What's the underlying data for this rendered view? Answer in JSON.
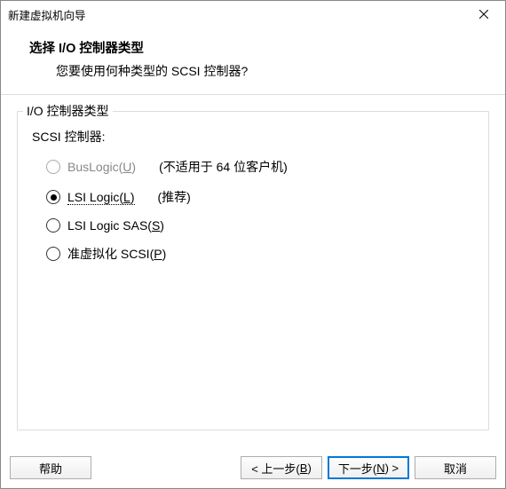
{
  "title": "新建虚拟机向导",
  "header": {
    "title": "选择 I/O 控制器类型",
    "question": "您要使用何种类型的 SCSI 控制器?"
  },
  "group": {
    "label": "I/O 控制器类型",
    "scsi_label": "SCSI 控制器:",
    "options": [
      {
        "label": "BusLogic",
        "accel": "U",
        "hint": "(不适用于 64 位客户机)",
        "disabled": true,
        "checked": false
      },
      {
        "label": "LSI Logic",
        "accel": "L",
        "hint": "(推荐)",
        "disabled": false,
        "checked": true
      },
      {
        "label": "LSI Logic SAS",
        "accel": "S",
        "hint": "",
        "disabled": false,
        "checked": false
      },
      {
        "label": "准虚拟化 SCSI",
        "accel": "P",
        "hint": "",
        "disabled": false,
        "checked": false
      }
    ]
  },
  "footer": {
    "help": "帮助",
    "back_prefix": "< 上一步(",
    "back_accel": "B",
    "back_suffix": ")",
    "next_prefix": "下一步(",
    "next_accel": "N",
    "next_suffix": ") >",
    "cancel": "取消"
  }
}
